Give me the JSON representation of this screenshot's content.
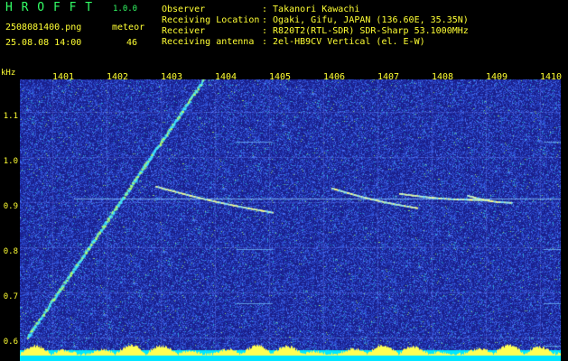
{
  "header": {
    "app_name": "H R O F F T",
    "version": "1.0.0",
    "filename": "2508081400.png",
    "datetime": "25.08.08 14:00",
    "meteor_label": "meteor",
    "meteor_count": "46"
  },
  "station": {
    "observer_label": "Observer",
    "observer_value": ": Takanori Kawachi",
    "location_label": "Receiving Location",
    "location_value": ": Ogaki, Gifu, JAPAN (136.60E, 35.35N)",
    "receiver_label": "Receiver",
    "receiver_value": ": R820T2(RTL-SDR) SDR-Sharp 53.1000MHz",
    "antenna_label": "Receiving antenna",
    "antenna_value": ": 2el-HB9CV Vertical (el. E-W)"
  },
  "axes": {
    "unit": "kHz",
    "y_ticks": [
      "1.1",
      "1.0",
      "0.9",
      "0.8",
      "0.7",
      "0.6"
    ],
    "x_ticks": [
      "1401",
      "1402",
      "1403",
      "1404",
      "1405",
      "1406",
      "1407",
      "1408",
      "1409",
      "1410"
    ]
  },
  "colors": {
    "background": "#1a1f8c",
    "noise": "#3a4fd6",
    "signal": "#ffff55",
    "baseline": "#00e6ff",
    "text": "#ffff33"
  }
}
